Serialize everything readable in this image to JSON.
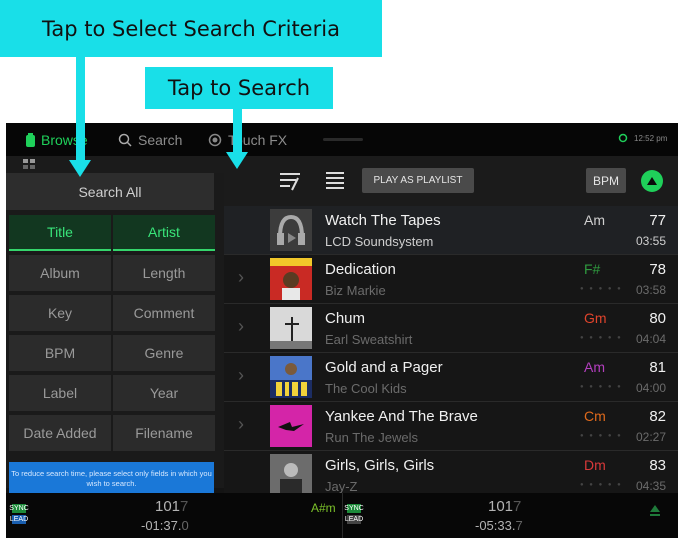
{
  "callouts": {
    "select_criteria": "Tap to Select Search Criteria",
    "search": "Tap to Search"
  },
  "topbar": {
    "browse": "Browse",
    "search": "Search",
    "touchfx": "Touch FX",
    "time": "12:52 pm"
  },
  "toolbar": {
    "play_as_playlist": "PLAY AS PLAYLIST",
    "bpm": "BPM"
  },
  "criteria": {
    "search_all": "Search All",
    "options": [
      {
        "label": "Title",
        "active": true
      },
      {
        "label": "Artist",
        "active": true
      },
      {
        "label": "Album",
        "active": false
      },
      {
        "label": "Length",
        "active": false
      },
      {
        "label": "Key",
        "active": false
      },
      {
        "label": "Comment",
        "active": false
      },
      {
        "label": "BPM",
        "active": false
      },
      {
        "label": "Genre",
        "active": false
      },
      {
        "label": "Label",
        "active": false
      },
      {
        "label": "Year",
        "active": false
      },
      {
        "label": "Date Added",
        "active": false
      },
      {
        "label": "Filename",
        "active": false
      }
    ],
    "hint": "To reduce search time, please select only fields in which you wish to search."
  },
  "tracks": [
    {
      "title": "Watch The Tapes",
      "artist": "LCD Soundsystem",
      "key": "Am",
      "key_color": "#cfcfcf",
      "bpm": "77",
      "time": "03:55"
    },
    {
      "title": "Dedication",
      "artist": "Biz Markie",
      "key": "F#",
      "key_color": "#2f9a3f",
      "bpm": "78",
      "time": "03:58"
    },
    {
      "title": "Chum",
      "artist": "Earl Sweatshirt",
      "key": "Gm",
      "key_color": "#e0442c",
      "bpm": "80",
      "time": "04:04"
    },
    {
      "title": "Gold and a Pager",
      "artist": "The Cool Kids",
      "key": "Am",
      "key_color": "#b43fbf",
      "bpm": "81",
      "time": "04:00"
    },
    {
      "title": "Yankee And The Brave",
      "artist": "Run The Jewels",
      "key": "Cm",
      "key_color": "#e06a1c",
      "bpm": "82",
      "time": "02:27"
    },
    {
      "title": "Girls, Girls, Girls",
      "artist": "Jay-Z",
      "key": "Dm",
      "key_color": "#d8393a",
      "bpm": "83",
      "time": "04:35"
    }
  ],
  "deck_left": {
    "bpm": "101",
    "bpm_suffix": "7",
    "time": "-01:37.",
    "time_suffix": "0",
    "key": "A#m",
    "sync": "SYNC",
    "lead": "LEAD"
  },
  "deck_right": {
    "bpm": "101",
    "bpm_suffix": "7",
    "time": "-05:33.",
    "time_suffix": "7",
    "sync": "SYNC",
    "lead": "LEAD"
  }
}
